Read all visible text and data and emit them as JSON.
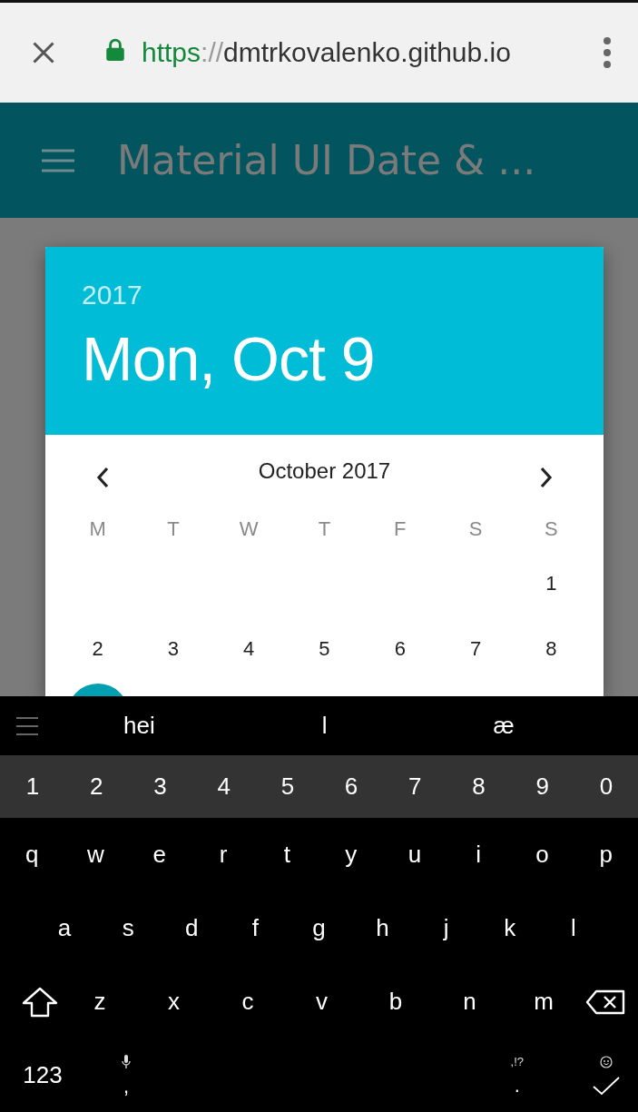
{
  "browser": {
    "url_scheme": "https",
    "url_separator": "://",
    "url_host": "dmtrkovalenko.github.io"
  },
  "app_bar": {
    "title": "Material UI Date & ..."
  },
  "date_dialog": {
    "year": "2017",
    "date": "Mon, Oct 9",
    "month": "October 2017",
    "weekdays": [
      "M",
      "T",
      "W",
      "T",
      "F",
      "S",
      "S"
    ],
    "weeks": [
      [
        "1"
      ],
      [
        "2",
        "3",
        "4",
        "5",
        "6",
        "7",
        "8"
      ]
    ]
  },
  "keyboard": {
    "suggestions": [
      "hei",
      "l",
      "æ"
    ],
    "number_row": [
      "1",
      "2",
      "3",
      "4",
      "5",
      "6",
      "7",
      "8",
      "9",
      "0"
    ],
    "letter_rows": [
      [
        "q",
        "w",
        "e",
        "r",
        "t",
        "y",
        "u",
        "i",
        "o",
        "p"
      ],
      [
        "a",
        "s",
        "d",
        "f",
        "g",
        "h",
        "j",
        "k",
        "l"
      ],
      [
        "z",
        "x",
        "c",
        "v",
        "b",
        "n",
        "m"
      ]
    ],
    "symbols_key": "123",
    "comma_key": ",",
    "period_key": ".",
    "period_hint": ",!?"
  }
}
